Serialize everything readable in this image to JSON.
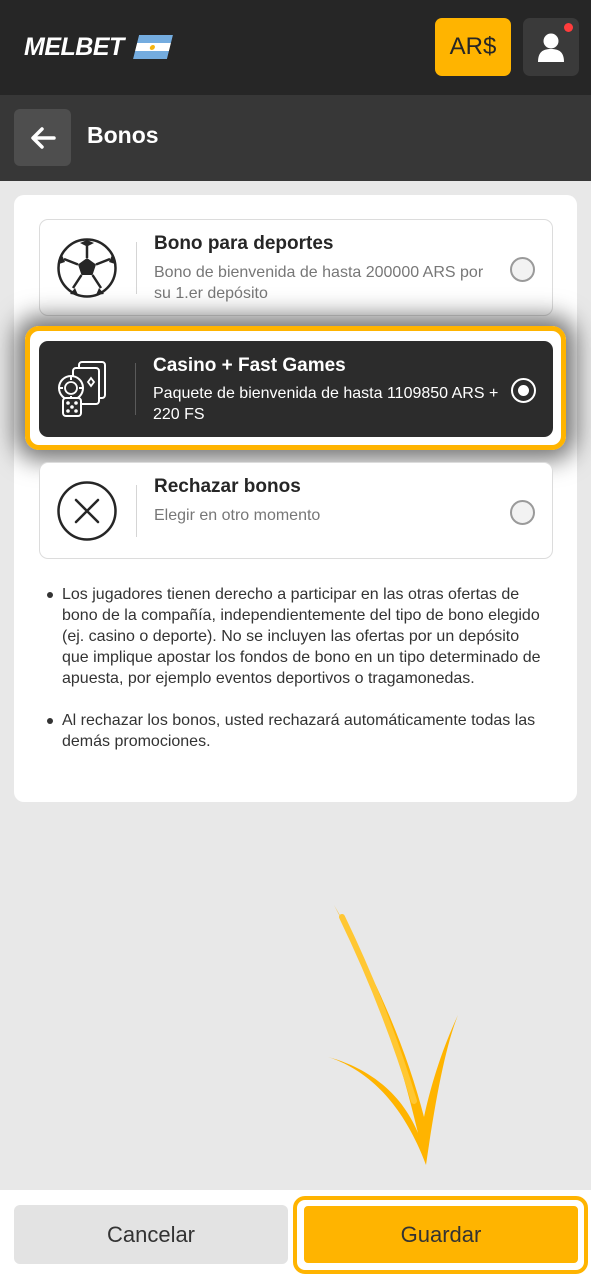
{
  "header": {
    "logo_text": "MELBET",
    "currency": "AR$",
    "icons": {
      "user": "user-icon",
      "flag": "argentina-flag-icon"
    },
    "colors": {
      "accent": "#ffb400",
      "topbar": "#262626",
      "notification": "#ff3c3c"
    }
  },
  "subheader": {
    "title": "Bonos",
    "back_icon": "arrow-left-icon"
  },
  "options": [
    {
      "title": "Bono para deportes",
      "description": "Bono de bienvenida de hasta 200000 ARS por su 1.er depósito",
      "icon": "soccer-ball-icon",
      "selected": false
    },
    {
      "title": "Casino + Fast Games",
      "description": "Paquete de bienvenida de hasta 1109850 ARS + 220 FS",
      "icon": "casino-chips-cards-dice-icon",
      "selected": true
    },
    {
      "title": "Rechazar bonos",
      "description": "Elegir en otro momento",
      "icon": "circle-x-icon",
      "selected": false
    }
  ],
  "notes": [
    "Los jugadores tienen derecho a participar en las otras ofertas de bono de la compañía, independientemente del tipo de bono elegido (ej. casino o deporte). No se incluyen las ofertas por un depósito que implique apostar los fondos de bono en un tipo determinado de apuesta, por ejemplo eventos deportivos o tragamonedas.",
    "Al rechazar los bonos, usted rechazará automáticamente todas las demás promociones."
  ],
  "footer": {
    "cancel_label": "Cancelar",
    "save_label": "Guardar"
  }
}
